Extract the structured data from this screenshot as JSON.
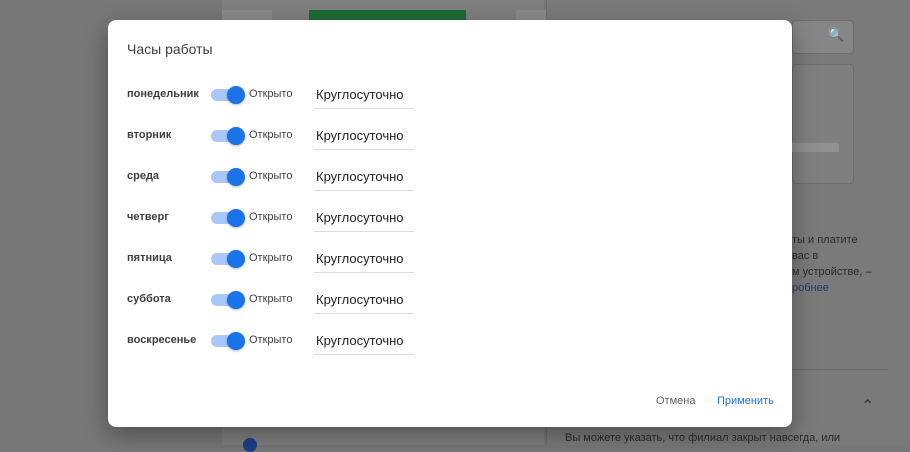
{
  "background": {
    "side_text_lines": [
      "ты и платите",
      "вас в",
      "м устройстве, –"
    ],
    "side_link": "робнее",
    "bottom_text": "Вы можете указать, что филиал закрыт навсегда, или"
  },
  "dialog": {
    "title": "Часы работы",
    "days": [
      {
        "day": "понедельник",
        "status": "Открыто",
        "hours": "Круглосуточно",
        "open": true
      },
      {
        "day": "вторник",
        "status": "Открыто",
        "hours": "Круглосуточно",
        "open": true
      },
      {
        "day": "среда",
        "status": "Открыто",
        "hours": "Круглосуточно",
        "open": true
      },
      {
        "day": "четверг",
        "status": "Открыто",
        "hours": "Круглосуточно",
        "open": true
      },
      {
        "day": "пятница",
        "status": "Открыто",
        "hours": "Круглосуточно",
        "open": true
      },
      {
        "day": "суббота",
        "status": "Открыто",
        "hours": "Круглосуточно",
        "open": true
      },
      {
        "day": "воскресенье",
        "status": "Открыто",
        "hours": "Круглосуточно",
        "open": true
      }
    ],
    "cancel_label": "Отмена",
    "apply_label": "Применить"
  },
  "colors": {
    "accent": "#1a73e8",
    "toggle_track": "#a8c7fa",
    "overlay": "#777777"
  },
  "icons": {
    "search": "search-icon",
    "chevron": "chevron-up-icon"
  }
}
